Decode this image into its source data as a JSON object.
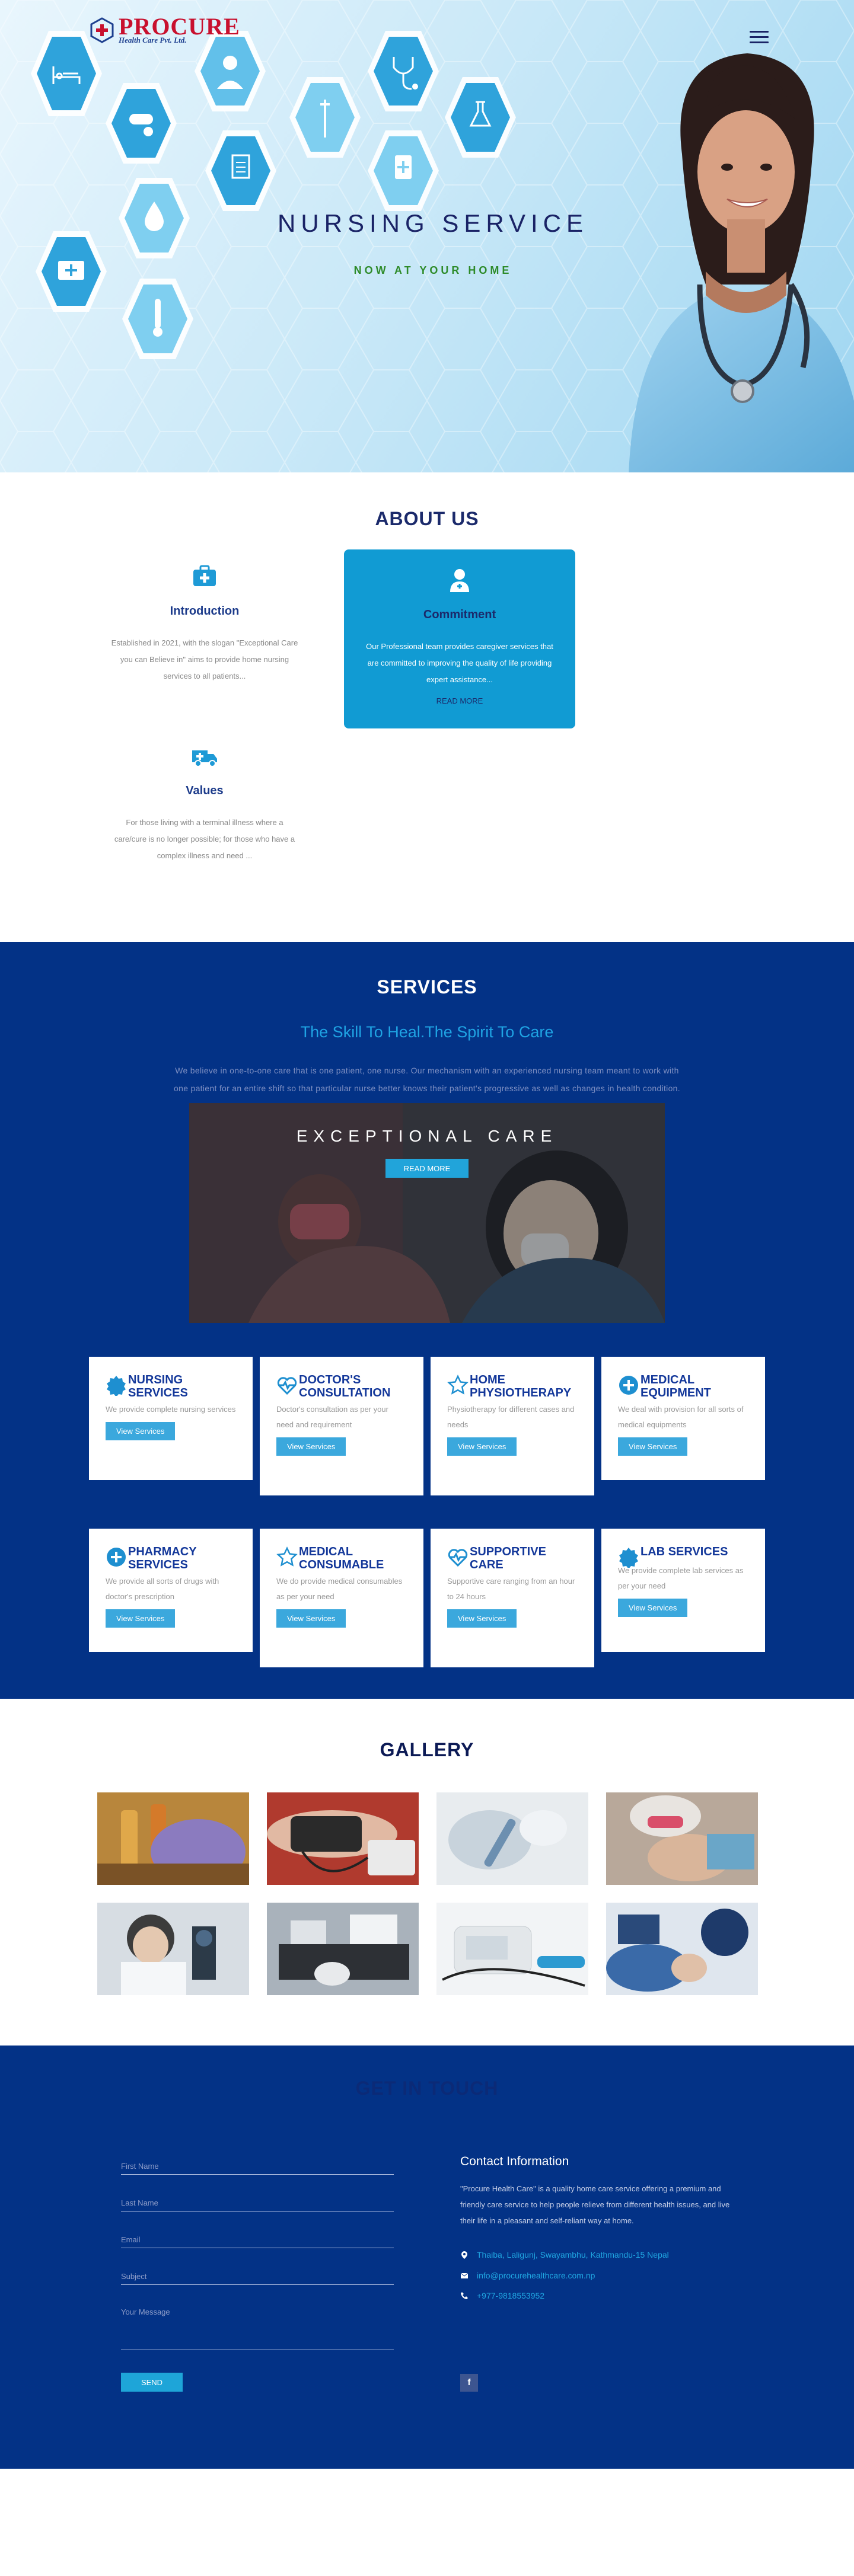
{
  "brand": {
    "name": "PROCURE",
    "tagline": "Health Care Pvt. Ltd."
  },
  "hero": {
    "title": "NURSING SERVICE",
    "subtitle": "NOW AT YOUR HOME"
  },
  "about": {
    "title": "ABOUT US",
    "cards": [
      {
        "title": "Introduction",
        "text": "Established in 2021, with the slogan \"Exceptional Care you can Believe in\" aims to provide home nursing services to all patients..."
      },
      {
        "title": "Commitment",
        "text": "Our Professional team provides caregiver services that are committed to improving the quality of life providing expert assistance...",
        "link": "READ MORE"
      },
      {
        "title": "Values",
        "text": "For those living with a terminal illness where a care/cure is no longer possible; for those who have a complex illness and need ..."
      }
    ]
  },
  "services": {
    "title": "SERVICES",
    "tagline": "The Skill To Heal.The Spirit To Care",
    "description_1": "We believe in one-to-one care that is one patient, one nurse. Our mechanism with an experienced nursing team meant to work with",
    "description_2": "one patient for an entire shift so that particular nurse better knows their patient's progressive as well as changes in health condition.",
    "banner": {
      "title": "EXCEPTIONAL CARE",
      "button": "READ MORE"
    },
    "cards": [
      {
        "title": "NURSING SERVICES",
        "text": "We provide complete nursing services",
        "button": "View Services"
      },
      {
        "title": "DOCTOR'S CONSULTATION",
        "text": "Doctor's consultation as per your need and requirement",
        "button": "View Services"
      },
      {
        "title": "HOME PHYSIOTHERAPY",
        "text": "Physiotherapy for different cases and needs",
        "button": "View Services"
      },
      {
        "title": "MEDICAL EQUIPMENT",
        "text": "We deal with provision for all sorts of medical equipments",
        "button": "View Services"
      },
      {
        "title": "PHARMACY SERVICES",
        "text": "We provide all sorts of drugs with doctor's prescription",
        "button": "View Services"
      },
      {
        "title": "MEDICAL CONSUMABLE",
        "text": "We do provide medical consumables as per your need",
        "button": "View Services"
      },
      {
        "title": "SUPPORTIVE CARE",
        "text": "Supportive care ranging from an hour to 24 hours",
        "button": "View Services"
      },
      {
        "title": "LAB SERVICES",
        "text": "We provide complete lab services as per your need",
        "button": "View Services"
      }
    ]
  },
  "gallery": {
    "title": "GALLERY"
  },
  "contact": {
    "title": "GET IN TOUCH",
    "form": {
      "first_name": "First Name",
      "last_name": "Last Name",
      "email": "Email",
      "subject": "Subject",
      "message": "Your Message",
      "send": "SEND"
    },
    "info_title": "Contact Information",
    "info_text": "\"Procure Health Care\" is a quality home care service offering a premium and friendly care service to help people relieve from different health issues, and live their life in a pleasant and self-reliant way at home.",
    "address": "Thaiba, Laligunj, Swayambhu, Kathmandu-15 Nepal",
    "email": "info@procurehealthcare.com.np",
    "phone": "+977-9818553952",
    "facebook": "f"
  },
  "colors": {
    "navy": "#033286",
    "accent": "#119bd3",
    "heading": "#1b2a6b",
    "brand_red": "#c8102e"
  }
}
